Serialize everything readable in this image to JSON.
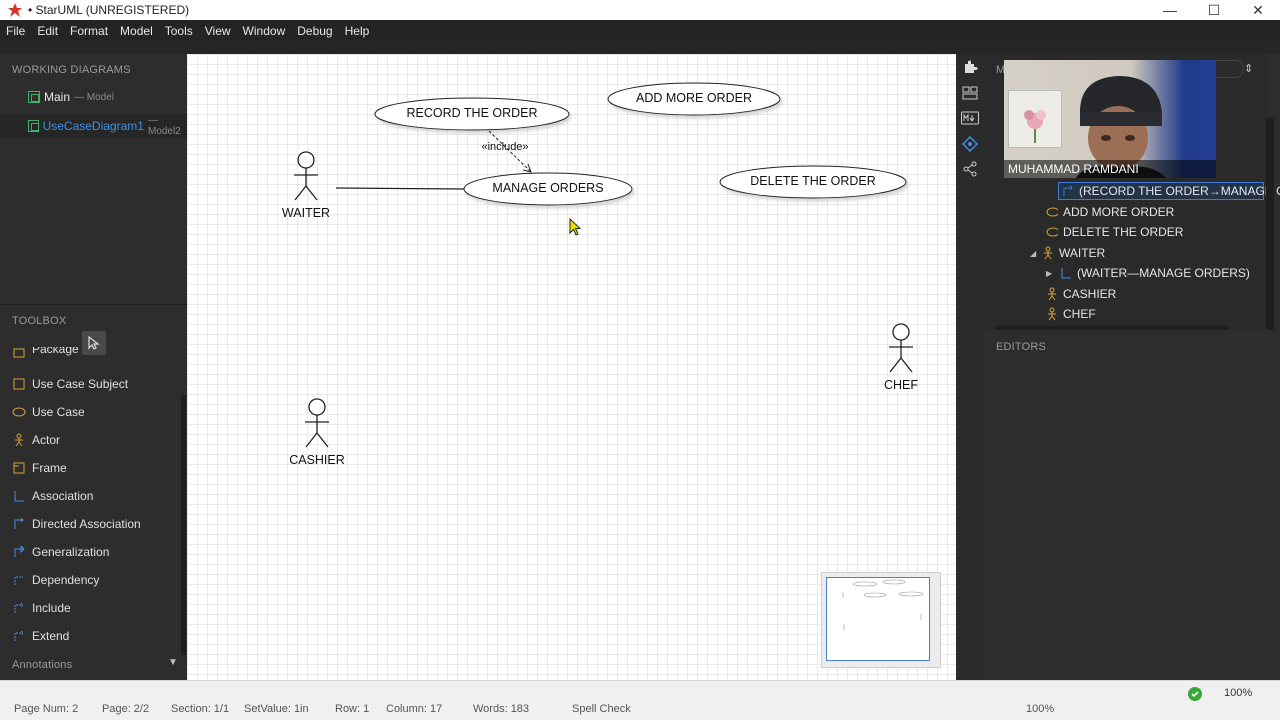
{
  "window": {
    "title": "• StarUML (UNREGISTERED)",
    "minimize": "—",
    "maximize": "☐",
    "close": "✕"
  },
  "menu": [
    "File",
    "Edit",
    "Format",
    "Model",
    "Tools",
    "View",
    "Window",
    "Debug",
    "Help"
  ],
  "working_diagrams": {
    "heading": "WORKING DIAGRAMS",
    "items": [
      {
        "label": "Main",
        "sub": "— Model",
        "color": "#e8e8e8"
      },
      {
        "label": "UseCaseDiagram1",
        "sub": "— Model2",
        "color": "#3f8fe0"
      }
    ]
  },
  "toolbox": {
    "heading": "TOOLBOX",
    "partial_item": "Package",
    "items": [
      {
        "label": "Use Case Subject",
        "icon": "subject-icon"
      },
      {
        "label": "Use Case",
        "icon": "usecase-icon"
      },
      {
        "label": "Actor",
        "icon": "actor-icon"
      },
      {
        "label": "Frame",
        "icon": "frame-icon"
      },
      {
        "label": "Association",
        "icon": "association-icon"
      },
      {
        "label": "Directed Association",
        "icon": "directed-association-icon"
      },
      {
        "label": "Generalization",
        "icon": "generalization-icon"
      },
      {
        "label": "Dependency",
        "icon": "dependency-icon"
      },
      {
        "label": "Include",
        "icon": "include-icon"
      },
      {
        "label": "Extend",
        "icon": "extend-icon"
      }
    ],
    "annotations": "Annotations"
  },
  "diagram": {
    "use_cases": {
      "record": "RECORD THE ORDER",
      "add": "ADD MORE ORDER",
      "manage": "MANAGE ORDERS",
      "delete": "DELETE THE ORDER"
    },
    "include_label": "«include»",
    "actors": {
      "waiter": "WAITER",
      "cashier": "CASHIER",
      "chef": "CHEF"
    }
  },
  "model_panel": {
    "heading_fragment": "M",
    "webcam_name": "MUHAMMAD RAMDANI",
    "tree": [
      {
        "label": "(RECORD THE ORDER→MANAGE ORI",
        "icon": "include-icon",
        "selected": true
      },
      {
        "label": "ADD MORE ORDER",
        "icon": "usecase-icon"
      },
      {
        "label": "DELETE THE ORDER",
        "icon": "usecase-icon"
      },
      {
        "label": "WAITER",
        "icon": "actor-icon",
        "expanded": true
      },
      {
        "label": "(WAITER—MANAGE ORDERS)",
        "icon": "association-icon",
        "collapsed": true
      },
      {
        "label": "CASHIER",
        "icon": "actor-icon"
      },
      {
        "label": "CHEF",
        "icon": "actor-icon"
      }
    ]
  },
  "editors": {
    "heading": "EDITORS"
  },
  "statusbar": {
    "items": [
      "Page Num: 2",
      "Page: 2/2",
      "Section: 1/1",
      "SetValue: 1in",
      "Row: 1",
      "Column: 17",
      "Words: 183",
      "Spell Check"
    ],
    "zoom": "100%",
    "zoom_small": "100%"
  },
  "colors": {
    "accent_blue": "#3f8fe0",
    "diagram_green": "#3fb26a",
    "toolbox_icon": "#d9a43a"
  }
}
